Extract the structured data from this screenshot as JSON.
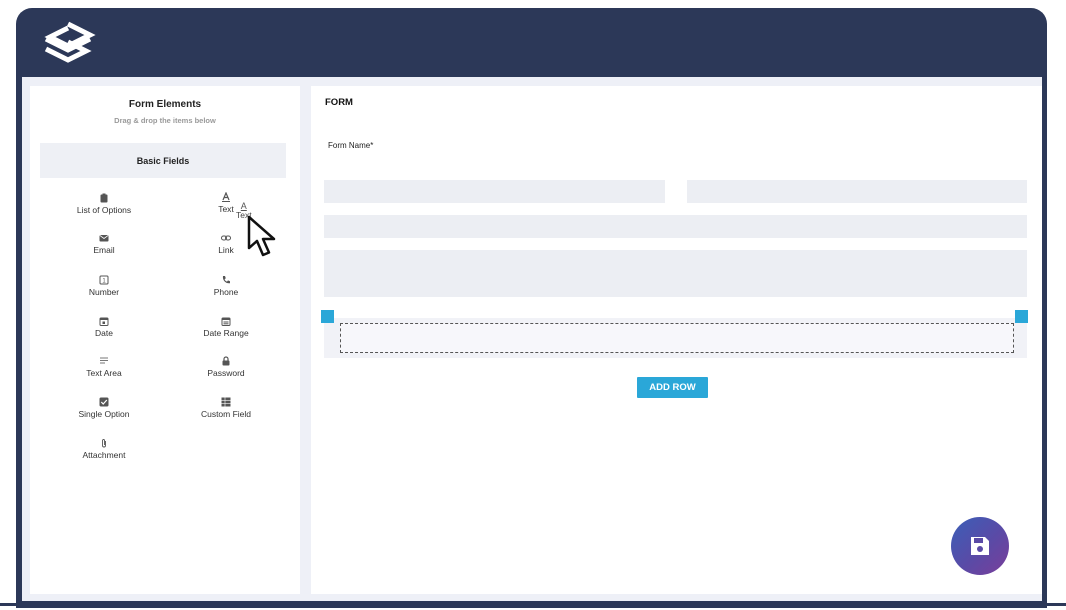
{
  "panel": {
    "title": "Form Elements",
    "subtitle": "Drag & drop the items below",
    "section": "Basic Fields"
  },
  "fields": [
    {
      "label": "List of Options",
      "icon": "clipboard-icon"
    },
    {
      "label": "Text",
      "icon": "text-a-icon"
    },
    {
      "label": "Email",
      "icon": "envelope-icon"
    },
    {
      "label": "Link",
      "icon": "link-icon"
    },
    {
      "label": "Number",
      "icon": "number-icon"
    },
    {
      "label": "Phone",
      "icon": "phone-icon"
    },
    {
      "label": "Date",
      "icon": "calendar-icon"
    },
    {
      "label": "Date Range",
      "icon": "calendar-range-icon"
    },
    {
      "label": "Text Area",
      "icon": "lines-icon"
    },
    {
      "label": "Password",
      "icon": "lock-icon"
    },
    {
      "label": "Single Option",
      "icon": "checkbox-icon"
    },
    {
      "label": "Custom Field",
      "icon": "grid-icon"
    },
    {
      "label": "Attachment",
      "icon": "paperclip-icon"
    }
  ],
  "drag_ghost": {
    "label": "Text"
  },
  "form": {
    "title": "FORM",
    "name_label": "Form Name*",
    "add_row": "ADD ROW"
  },
  "colors": {
    "header": "#2c3858",
    "accent": "#2aa7d8",
    "field_bg": "#eceef3"
  }
}
